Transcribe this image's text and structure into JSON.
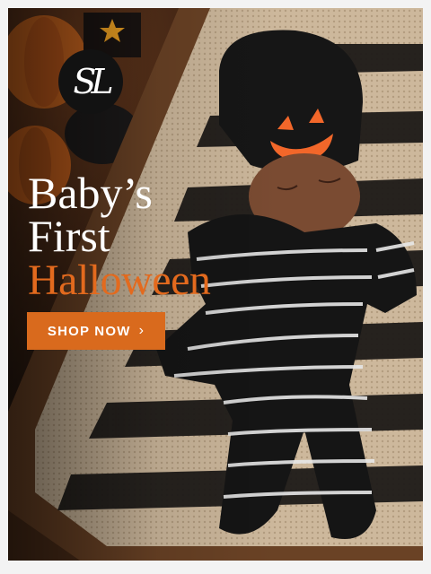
{
  "ad": {
    "logo_text": "SL",
    "headline_line1": "Baby’s",
    "headline_line2": "First",
    "headline_line3": "Halloween",
    "cta_label": "SHOP NOW",
    "cta_chevron": "›"
  },
  "colors": {
    "accent": "#d96a1d",
    "headline_orange": "#e36a1e",
    "wood": "#3b2417"
  },
  "icons": [
    "logo-monogram",
    "chevron-right-icon",
    "jack-o-lantern-icon"
  ]
}
